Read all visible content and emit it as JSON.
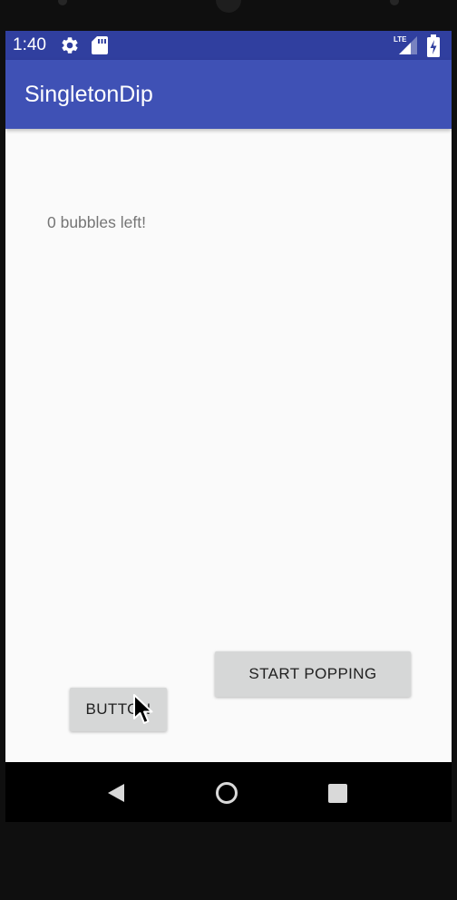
{
  "status_bar": {
    "time": "1:40",
    "icons": [
      "gear-icon",
      "sd-card-icon",
      "lte-signal-icon",
      "battery-icon"
    ],
    "network_label": "LTE",
    "background": "#303f9f"
  },
  "app_bar": {
    "title": "SingletonDip",
    "background": "#3f51b5"
  },
  "content": {
    "bubbles_text": "0 bubbles left!"
  },
  "buttons": {
    "start_popping_label": "START POPPING",
    "small_button_label": "BUTTON"
  },
  "nav_bar": {
    "icons": [
      "back-icon",
      "home-icon",
      "recents-icon"
    ]
  },
  "colors": {
    "screen_background": "#fafafa",
    "button_background": "#d6d7d7",
    "text_secondary": "#757575"
  }
}
